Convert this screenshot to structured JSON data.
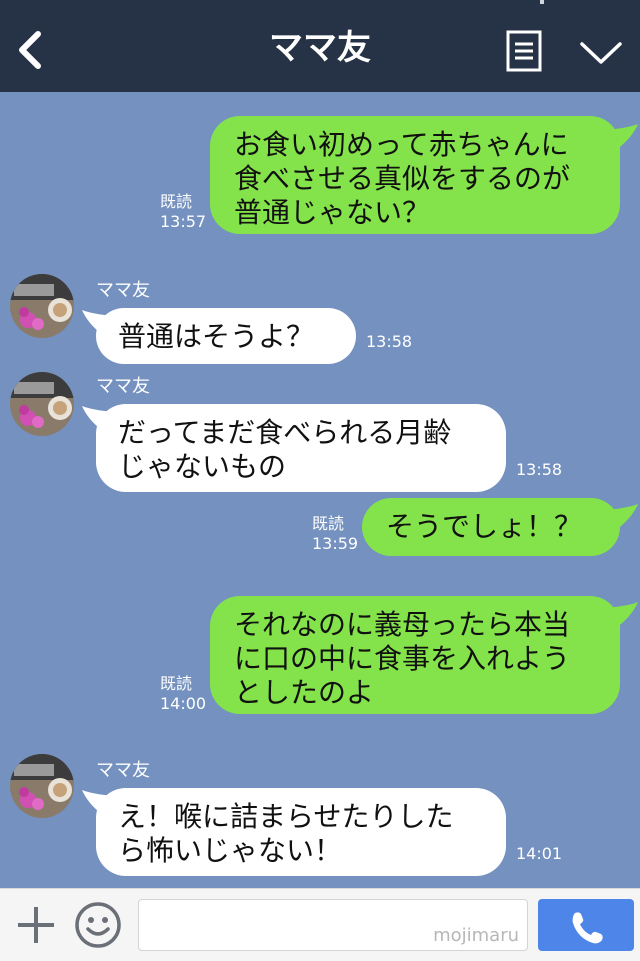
{
  "header": {
    "title": "ママ友"
  },
  "messages": [
    {
      "side": "me",
      "text": "お食い初めって赤ちゃんに\n食べさせる真似をするのが\n普通じゃない？",
      "read": "既読",
      "time": "13:57"
    },
    {
      "side": "them",
      "sender": "ママ友",
      "text": "普通はそうよ？",
      "time": "13:58"
    },
    {
      "side": "them",
      "sender": "ママ友",
      "text": "だってまだ食べられる月齢\nじゃないもの",
      "time": "13:58"
    },
    {
      "side": "me",
      "text": "そうでしょ！？",
      "read": "既読",
      "time": "13:59"
    },
    {
      "side": "me",
      "text": "それなのに義母ったら本当\nに口の中に食事を入れよう\nとしたのよ",
      "read": "既読",
      "time": "14:00"
    },
    {
      "side": "them",
      "sender": "ママ友",
      "text": "え！喉に詰まらせたりした\nら怖いじゃない！",
      "time": "14:01"
    }
  ],
  "input": {
    "value": "",
    "watermark": "mojimaru"
  },
  "colors": {
    "background": "#7491bf",
    "header": "#263246",
    "my_bubble": "#84e34a",
    "their_bubble": "#ffffff",
    "call_button": "#4d86e8"
  }
}
